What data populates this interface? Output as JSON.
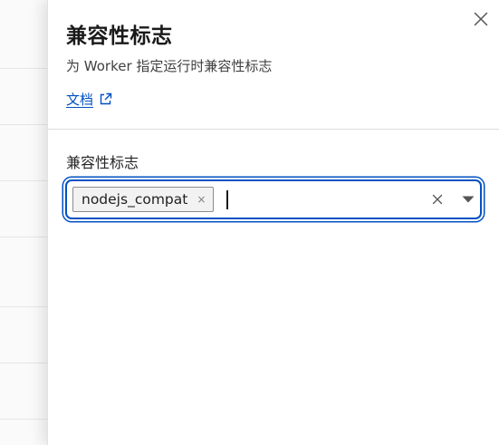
{
  "panel": {
    "title": "兼容性标志",
    "subtitle": "为 Worker 指定运行时兼容性标志",
    "docs_link_label": "文档"
  },
  "field": {
    "label": "兼容性标志",
    "selected_flags": [
      "nodejs_compat"
    ]
  },
  "icons": {
    "close": "close-icon",
    "external_link": "external-link-icon",
    "chip_remove": "×",
    "clear": "clear-icon",
    "dropdown": "caret-down-icon"
  },
  "colors": {
    "accent": "#0051c3"
  }
}
